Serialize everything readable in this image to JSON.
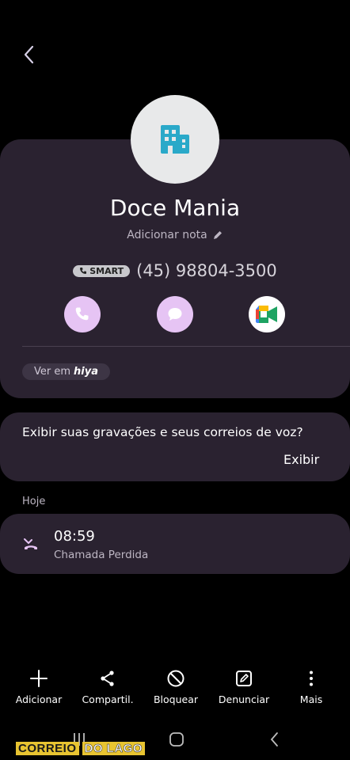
{
  "header": {
    "back_icon": "chevron-left-icon"
  },
  "contact": {
    "avatar_icon": "building-icon",
    "name": "Doce Mania",
    "add_note_label": "Adicionar nota",
    "badge_label": "SMART",
    "phone": "(45) 98804-3500",
    "actions": [
      "phone-icon",
      "message-icon",
      "meet-video-icon"
    ],
    "hiya_prefix": "Ver em",
    "hiya_brand": "hiya"
  },
  "voice_prompt": {
    "text": "Exibir suas gravações e seus correios de voz?",
    "action_label": "Exibir"
  },
  "history": {
    "section_label": "Hoje",
    "calls": [
      {
        "time": "08:59",
        "type": "Chamada Perdida",
        "icon": "missed-call-icon"
      }
    ]
  },
  "bottom_bar": {
    "items": [
      {
        "label": "Adicionar",
        "icon": "plus-icon"
      },
      {
        "label": "Compartil.",
        "icon": "share-icon"
      },
      {
        "label": "Bloquear",
        "icon": "block-icon"
      },
      {
        "label": "Denunciar",
        "icon": "report-icon"
      },
      {
        "label": "Mais",
        "icon": "more-vertical-icon"
      }
    ]
  },
  "watermark": {
    "part1": "CORREIO",
    "part2": "DO LAGO"
  },
  "colors": {
    "card": "#2a2230",
    "accent": "#e6c4f4",
    "missed": "#e6c4f4",
    "avatar_icon": "#2aa9c9"
  }
}
